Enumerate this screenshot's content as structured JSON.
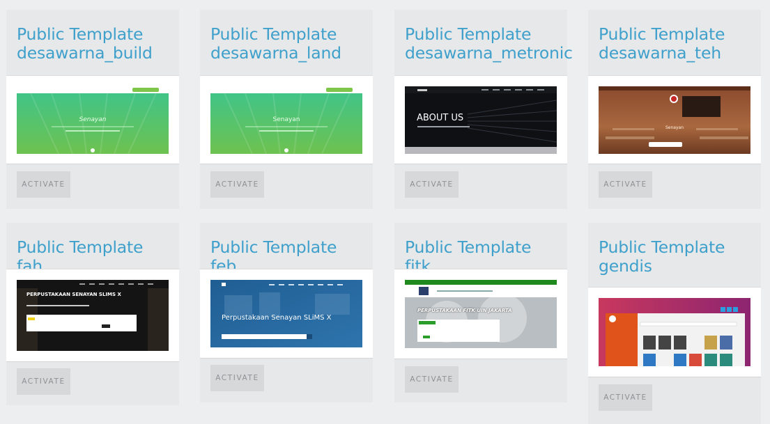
{
  "templates": [
    {
      "title": "Public Template desawarna_build",
      "button": "ACTIVATE",
      "thumb_caption": "Senayan",
      "thumb_icon": "book-icon"
    },
    {
      "title": "Public Template desawarna_land",
      "button": "ACTIVATE",
      "thumb_caption": "Senayan",
      "thumb_icon": "book-icon"
    },
    {
      "title": "Public Template desawarna_metronic",
      "button": "ACTIVATE",
      "thumb_caption": "ABOUT US",
      "thumb_icon": "none"
    },
    {
      "title": "Public Template desawarna_teh",
      "button": "ACTIVATE",
      "thumb_caption": "Senayan",
      "thumb_icon": "logo-icon"
    },
    {
      "title": "Public Template fah",
      "button": "ACTIVATE",
      "thumb_caption": "PERPUSTAKAAN SENAYAN SLIMS X",
      "thumb_icon": "none"
    },
    {
      "title": "Public Template feb",
      "button": "ACTIVATE",
      "thumb_caption": "Perpustakaan Senayan SLiMS X",
      "thumb_icon": "none"
    },
    {
      "title": "Public Template fitk",
      "button": "ACTIVATE",
      "thumb_caption": "PERPUSTAKAAN FITK UIN JAKARTA",
      "thumb_icon": "none"
    },
    {
      "title": "Public Template gendis",
      "button": "ACTIVATE",
      "thumb_caption": "",
      "thumb_icon": "none"
    }
  ],
  "colors": {
    "title": "#3fa0cc",
    "card_bg": "#e6e8e9",
    "page_bg": "#eceeef",
    "button_bg": "#d6d8d9",
    "button_text": "#8e9193"
  }
}
